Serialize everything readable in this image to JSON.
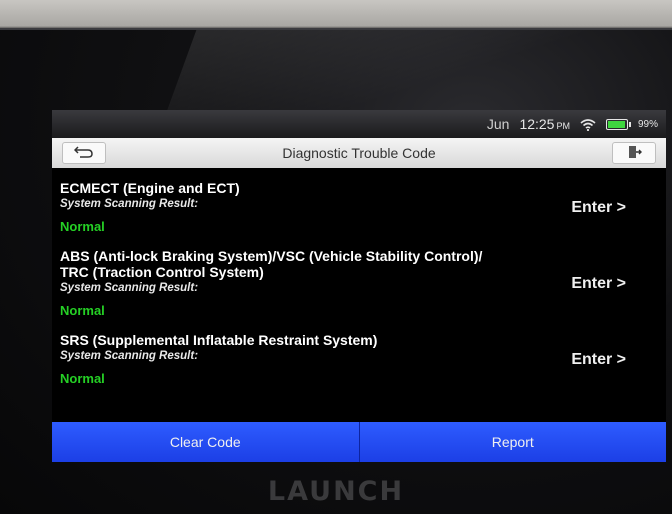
{
  "status_bar": {
    "date": "Jun",
    "time": "12:25",
    "ampm": "PM",
    "battery_percent": "99%",
    "battery_level": 0.99,
    "wifi_icon": "wifi-icon",
    "battery_icon": "battery-icon"
  },
  "title_bar": {
    "title": "Diagnostic Trouble Code",
    "back_icon": "back-arrow-icon",
    "exit_icon": "exit-icon"
  },
  "systems": [
    {
      "name_line1": "ECMECT (Engine and ECT)",
      "name_line2": "",
      "result_label": "System Scanning Result:",
      "status": "Normal",
      "enter_label": "Enter >"
    },
    {
      "name_line1": "ABS (Anti-lock Braking System)/VSC (Vehicle Stability Control)/",
      "name_line2": "TRC (Traction Control System)",
      "result_label": "System Scanning Result:",
      "status": "Normal",
      "enter_label": "Enter >"
    },
    {
      "name_line1": "SRS (Supplemental Inflatable Restraint System)",
      "name_line2": "",
      "result_label": "System Scanning Result:",
      "status": "Normal",
      "enter_label": "Enter >"
    }
  ],
  "bottom_bar": {
    "clear_label": "Clear Code",
    "report_label": "Report"
  },
  "device": {
    "brand": "LAUNCH"
  },
  "colors": {
    "status_ok": "#25d025",
    "button_blue": "#1c3fe6"
  }
}
